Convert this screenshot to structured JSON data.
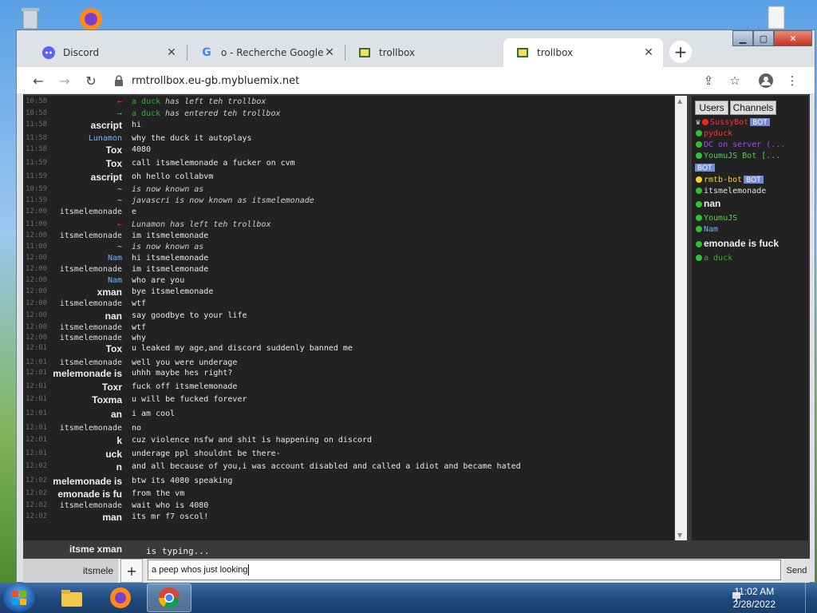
{
  "tabs": [
    {
      "label": "Discord",
      "icon": "discord-icon",
      "color": "#5865f2"
    },
    {
      "label": "o - Recherche Google",
      "icon": "google-icon"
    },
    {
      "label": "trollbox",
      "icon": "trollbox-icon"
    },
    {
      "label": "trollbox",
      "icon": "trollbox-icon",
      "active": true
    }
  ],
  "toolbar": {
    "url": "rmtrollbox.eu-gb.mybluemix.net"
  },
  "chat": [
    {
      "ts": "10:58",
      "arrow": "←",
      "arrow_color": "#e03030",
      "nick": "a duck",
      "nick_color": "#30b030",
      "text": "has left teh trollbox",
      "sys": true
    },
    {
      "ts": "10:58",
      "arrow": "→",
      "arrow_color": "#30c030",
      "nick": "a duck",
      "nick_color": "#30b030",
      "text": "has entered teh trollbox",
      "sys": true
    },
    {
      "ts": "11:58",
      "nick": "ascript",
      "big": true,
      "text": "hi"
    },
    {
      "ts": "11:58",
      "nick": "Lunamon",
      "nick_color": "#6db4ff",
      "text": "why the duck it autoplays"
    },
    {
      "ts": "11:58",
      "nick": "Tox",
      "big": true,
      "text": "4080"
    },
    {
      "ts": "11:59",
      "nick": "Tox",
      "big": true,
      "text": "call itsmelemonade a fucker on cvm"
    },
    {
      "ts": "11:59",
      "nick": "ascript",
      "big": true,
      "text": "oh hello collabvm"
    },
    {
      "ts": "10:59",
      "nick": "~",
      "text": "is now known as",
      "sys": true
    },
    {
      "ts": "11:59",
      "nick": "~",
      "text": "javascri is now known as itsmelemonade",
      "sys": true
    },
    {
      "ts": "12:00",
      "nick": "itsmelemonade",
      "text": "e"
    },
    {
      "ts": "11:00",
      "arrow": "←",
      "arrow_color": "#e03030",
      "nick": "",
      "text": "Lunamon has left teh trollbox",
      "sys": true
    },
    {
      "ts": "12:00",
      "nick": "itsmelemonade",
      "text": "im itsmelemonade"
    },
    {
      "ts": "11:00",
      "nick": "~",
      "text": "is now known as",
      "sys": true
    },
    {
      "ts": "12:00",
      "nick": "Nam",
      "nick_color": "#6db4ff",
      "text": "hi itsmelemonade"
    },
    {
      "ts": "12:00",
      "nick": "itsmelemonade",
      "text": "im itsmelemonade"
    },
    {
      "ts": "12:00",
      "nick": "Nam",
      "nick_color": "#6db4ff",
      "text": "who are you"
    },
    {
      "ts": "12:00",
      "nick": "xman",
      "big": true,
      "text": "bye itsmelemonade"
    },
    {
      "ts": "12:00",
      "nick": "itsmelemonade",
      "text": "wtf"
    },
    {
      "ts": "12:00",
      "nick": "nan",
      "big": true,
      "text": "say goodbye to your life"
    },
    {
      "ts": "12:00",
      "nick": "itsmelemonade",
      "text": "wtf"
    },
    {
      "ts": "12:00",
      "nick": "itsmelemonade",
      "text": "why"
    },
    {
      "ts": "12:01",
      "nick": "Tox",
      "big": true,
      "text": "u leaked my age,and discord suddenly banned me"
    },
    {
      "ts": "12:01",
      "nick": "itsmelemonade",
      "text": "well you were underage"
    },
    {
      "ts": "12:01",
      "nick": "melemonade is",
      "big": true,
      "text": "uhhh maybe hes right?"
    },
    {
      "ts": "12:01",
      "nick": "Toxr",
      "big": true,
      "text": "fuck off itsmelemonade"
    },
    {
      "ts": "12:01",
      "nick": "Toxma",
      "big": true,
      "text": "u will be fucked forever"
    },
    {
      "ts": "12:01",
      "nick": "an",
      "big": true,
      "text": "i am cool"
    },
    {
      "ts": "12:01",
      "nick": "itsmelemonade",
      "text": "no"
    },
    {
      "ts": "12:01",
      "nick": "k",
      "big": true,
      "text": "cuz violence nsfw and shit is happening on discord"
    },
    {
      "ts": "12:01",
      "nick": "uck",
      "big": true,
      "text": "underage ppl shouldnt be there-"
    },
    {
      "ts": "12:02",
      "nick": "n",
      "big": true,
      "text": "and all because of you,i was account disabled and called a idiot and became hated"
    },
    {
      "ts": "12:02",
      "nick": "melemonade is",
      "big": true,
      "text": "btw its 4080 speaking"
    },
    {
      "ts": "12:02",
      "nick": "emonade is fu",
      "big": true,
      "text": "from the vm"
    },
    {
      "ts": "12:02",
      "nick": "itsmelemonade",
      "text": "wait who is 4080"
    },
    {
      "ts": "12:02",
      "nick": "man",
      "big": true,
      "text": "its mr f7 oscol!"
    }
  ],
  "panel": {
    "tab_users": "Users",
    "tab_channels": "Channels",
    "users": [
      {
        "name": "SussyBot",
        "color": "#ff3030",
        "dot": "#ff2020",
        "bot": true,
        "crown": true
      },
      {
        "name": "pyduck",
        "color": "#ff3030",
        "dot": "#30c030"
      },
      {
        "name": "DC on server (...",
        "color": "#b040ff",
        "dot": "#30c030"
      },
      {
        "name": "YoumuJS Bot [...",
        "color": "#50d050",
        "dot": "#30c030",
        "bot_line": true
      },
      {
        "name": "rmtb-bot",
        "color": "#ffcc33",
        "dot": "#ffd020",
        "bot": true
      },
      {
        "name": "itsmelemonade",
        "color": "#e0e0e0",
        "dot": "#30c030"
      },
      {
        "name": "nan",
        "color": "#f0f0f0",
        "dot": "#30c030",
        "big": true
      },
      {
        "name": "YoumuJS",
        "color": "#50d050",
        "dot": "#30c030"
      },
      {
        "name": "Nam",
        "color": "#6db4ff",
        "dot": "#30c030"
      },
      {
        "name": "emonade is fuck",
        "color": "#f0f0f0",
        "dot": "#30c030",
        "big": true
      },
      {
        "name": "a duck",
        "color": "#30b030",
        "dot": "#30c030"
      }
    ],
    "bot_label": "BOT"
  },
  "typing": {
    "nicks": "itsme  xman",
    "text": "is typing..."
  },
  "input": {
    "nick": "itsmele",
    "value": "a peep whos just looking",
    "plus": "+",
    "send": "Send"
  },
  "taskbar": {
    "time": "11:02 AM",
    "date": "2/28/2022"
  }
}
